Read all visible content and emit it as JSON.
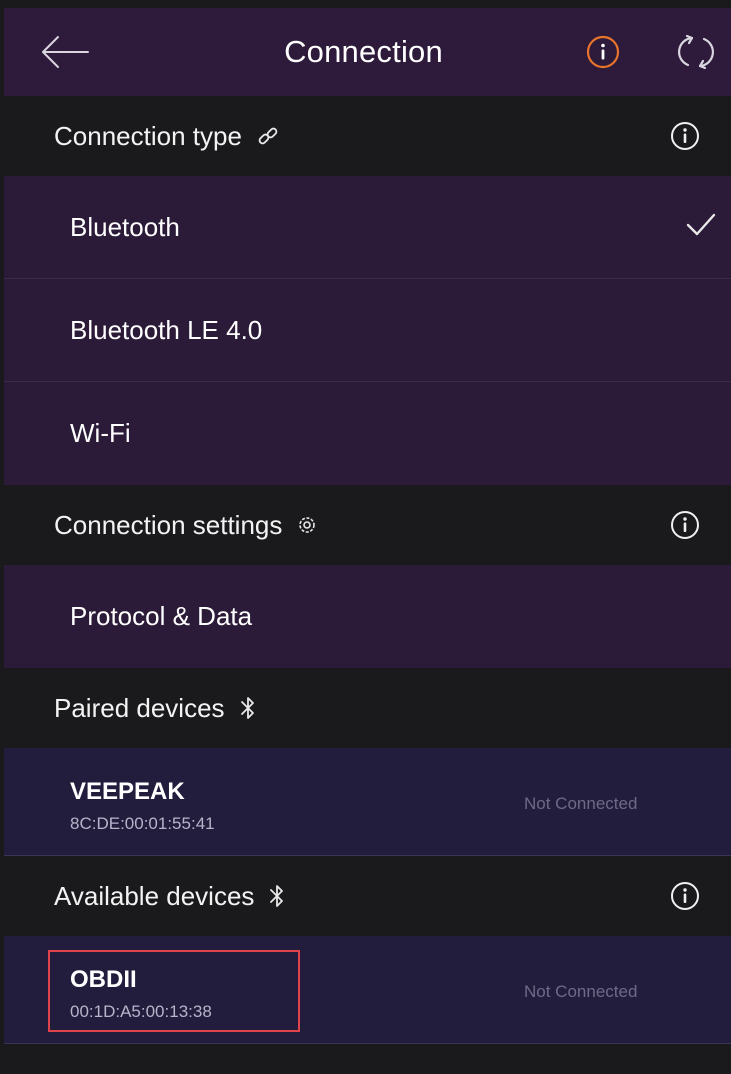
{
  "header": {
    "title": "Connection",
    "back_icon": "arrow-left-icon",
    "info_icon": "info-circle-icon",
    "refresh_icon": "refresh-icon",
    "accent_color": "#e8742c"
  },
  "connection_type": {
    "label": "Connection type",
    "icon": "link-icon",
    "options": [
      {
        "label": "Bluetooth",
        "selected": true
      },
      {
        "label": "Bluetooth LE 4.0",
        "selected": false
      },
      {
        "label": "Wi-Fi",
        "selected": false
      }
    ]
  },
  "connection_settings": {
    "label": "Connection settings",
    "icon": "gear-icon",
    "items": [
      {
        "label": "Protocol & Data"
      }
    ]
  },
  "paired_devices": {
    "label": "Paired devices",
    "icon": "bluetooth-icon",
    "devices": [
      {
        "name": "VEEPEAK",
        "mac": "8C:DE:00:01:55:41",
        "status": "Not Connected"
      }
    ]
  },
  "available_devices": {
    "label": "Available devices",
    "icon": "bluetooth-icon",
    "devices": [
      {
        "name": "OBDII",
        "mac": "00:1D:A5:00:13:38",
        "status": "Not Connected",
        "highlighted": true
      }
    ]
  },
  "colors": {
    "topbar": "#2e1a3a",
    "section_header": "#1a1a1c",
    "option_row": "#2b1a38",
    "device_row": "#231d3d",
    "highlight_border": "#e0434a"
  }
}
